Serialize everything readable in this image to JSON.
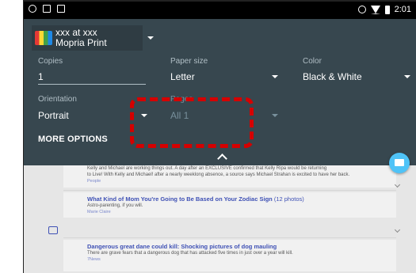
{
  "status_bar": {
    "time": "2:01"
  },
  "printer": {
    "line1": "xxx at xxx",
    "line2": "Mopria Print"
  },
  "options": {
    "copies": {
      "label": "Copies",
      "value": "1"
    },
    "paper_size": {
      "label": "Paper size",
      "value": "Letter"
    },
    "color": {
      "label": "Color",
      "value": "Black & White"
    },
    "orientation": {
      "label": "Orientation",
      "value": "Portrait"
    },
    "pages": {
      "label": "Pages",
      "value": "All 1"
    },
    "more_options": "MORE OPTIONS"
  },
  "feed": {
    "item1": {
      "body_line1": "Kelly and Michael are working things out. A day after an EXCLUSIVE confirmed that Kelly Ripa would be returning",
      "body_line2": "to Live! With Kelly and Michael! after a nearly weeklong absence, a source says Michael Strahan is excited to have her back.",
      "source": "People"
    },
    "item2": {
      "title": "What Kind of Mom You're Going to Be Based on Your Zodiac Sign",
      "count": "(12 photos)",
      "body": "Astro-parenting, if you will.",
      "source": "Marie Claire"
    },
    "item3": {
      "title": "Dangerous great dane could kill: Shocking pictures of dog mauling",
      "body": "There are grave fears that a dangerous dog that has attacked five times in just over a year will kill.",
      "source": "7News"
    }
  },
  "colors": {
    "panel": "#37474f",
    "fab": "#4fc3f7",
    "highlight": "#d50000",
    "link": "#3f51b5"
  }
}
